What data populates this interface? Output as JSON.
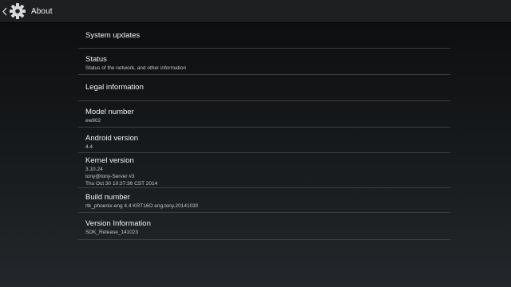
{
  "header": {
    "title": "About"
  },
  "items": [
    {
      "title": "System updates",
      "lines": []
    },
    {
      "title": "Status",
      "lines": [
        "Status of the network, and other information"
      ]
    },
    {
      "title": "Legal information",
      "lines": []
    },
    {
      "title": "Model number",
      "lines": [
        "ew902"
      ]
    },
    {
      "title": "Android version",
      "lines": [
        "4.4"
      ]
    },
    {
      "title": "Kernel version",
      "lines": [
        "3.10.24",
        "tony@tony-Server #3",
        "Thu Oct 30 10:37:36 CST 2014"
      ]
    },
    {
      "title": "Build number",
      "lines": [
        "rtk_phoenix-eng 4.4 KRT16O eng.tony.20141030"
      ]
    },
    {
      "title": "Version Information",
      "lines": [
        "SDK_Release_141023"
      ]
    }
  ],
  "colors": {
    "action_bar": "#1e1f20",
    "divider": "#3b3e41",
    "title_text": "#f2f2f2",
    "summary_text": "#c6c6c6"
  },
  "icons": [
    "chevron-left-icon",
    "settings-gear-icon"
  ]
}
